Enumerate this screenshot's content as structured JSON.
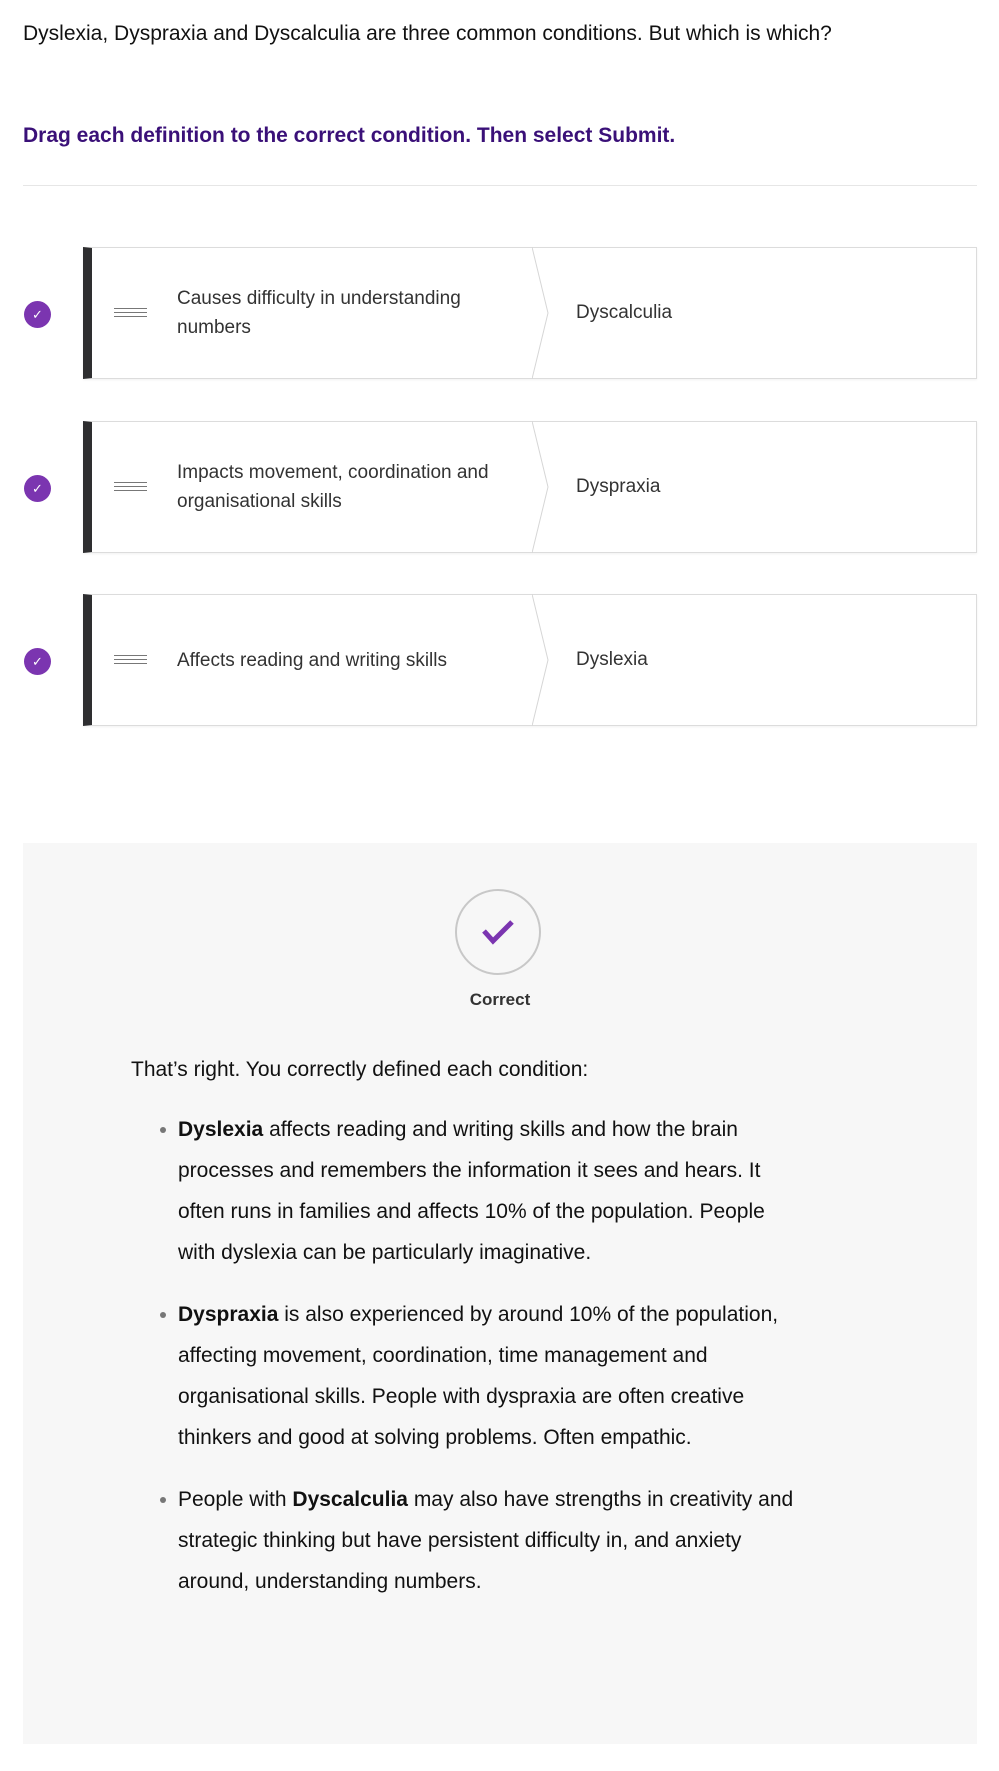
{
  "intro": "Dyslexia, Dyspraxia and Dyscalculia are three common conditions. But which is which?",
  "instruction": "Drag each definition to the correct condition. Then select Submit.",
  "pairs": [
    {
      "definition": "Causes difficulty in understanding numbers",
      "condition": "Dyscalculia",
      "status": "correct"
    },
    {
      "definition": "Impacts movement, coordination and organisational skills",
      "condition": "Dyspraxia",
      "status": "correct"
    },
    {
      "definition": "Affects reading and writing skills",
      "condition": "Dyslexia",
      "status": "correct"
    }
  ],
  "feedback": {
    "status": "Correct",
    "intro": "That’s right. You correctly defined each condition:",
    "items": [
      {
        "pre": " ",
        "bold": "Dyslexia",
        "post": " affects reading and writing skills and how the brain processes and remembers the information it sees and hears. It often runs in families and affects 10% of the population. People with dyslexia can be particularly imaginative."
      },
      {
        "pre": "",
        "bold": "Dyspraxia",
        "post": " is also experienced by around 10% of the population, affecting movement, coordination, time management and organisational skills. People with dyspraxia are often creative thinkers and good at solving problems. Often empathic."
      },
      {
        "pre": "People with ",
        "bold": "Dyscalculia",
        "post": " may also have strengths in creativity and strategic thinking but have persistent difficulty in, and anxiety around, understanding numbers."
      }
    ]
  },
  "colors": {
    "accent": "#7b35b0",
    "instruction": "#3a1078",
    "panel": "#f7f7f7"
  }
}
